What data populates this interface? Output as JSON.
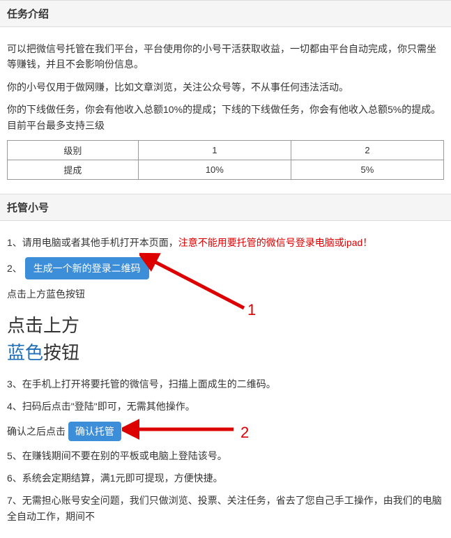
{
  "section1": {
    "title": "任务介绍",
    "p1": "可以把微信号托管在我们平台，平台使用你的小号干活获取收益，一切都由平台自动完成，你只需坐等赚钱，并且不会影响份信息。",
    "p2": "你的小号仅用于做网赚，比如文章浏览，关注公众号等，不从事任何违法活动。",
    "p3": "你的下线做任务，你会有他收入总额10%的提成；下线的下线做任务，你会有他收入总额5%的提成。目前平台最多支持三级",
    "table": {
      "headers": [
        "级别",
        "1",
        "2"
      ],
      "row": [
        "提成",
        "10%",
        "5%"
      ]
    }
  },
  "section2": {
    "title": "托管小号",
    "step1_prefix": "1、请用电脑或者其他手机打开本页面，",
    "step1_warn": "注意不能用要托管的微信号登录电脑或ipad！",
    "step2_prefix": "2、",
    "btn_generate": "生成一个新的登录二维码",
    "hint1": "点击上方蓝色按钮",
    "big1": "点击上方",
    "big2_blue": "蓝色",
    "big2_rest": "按钮",
    "step3": "3、在手机上打开将要托管的微信号，扫描上面成生的二维码。",
    "step4": "4、扫码后点击\"登陆\"即可，无需其他操作。",
    "confirm_prefix": "确认之后点击",
    "btn_confirm": "确认托管",
    "step5": "5、在赚钱期间不要在别的平板或电脑上登陆该号。",
    "step6": "6、系统会定期结算，满1元即可提现，方便快捷。",
    "step7": "7、无需担心账号安全问题，我们只做浏览、投票、关注任务，省去了您自己手工操作，由我们的电脑全自动工作，期间不",
    "marker1": "1",
    "marker2": "2"
  }
}
